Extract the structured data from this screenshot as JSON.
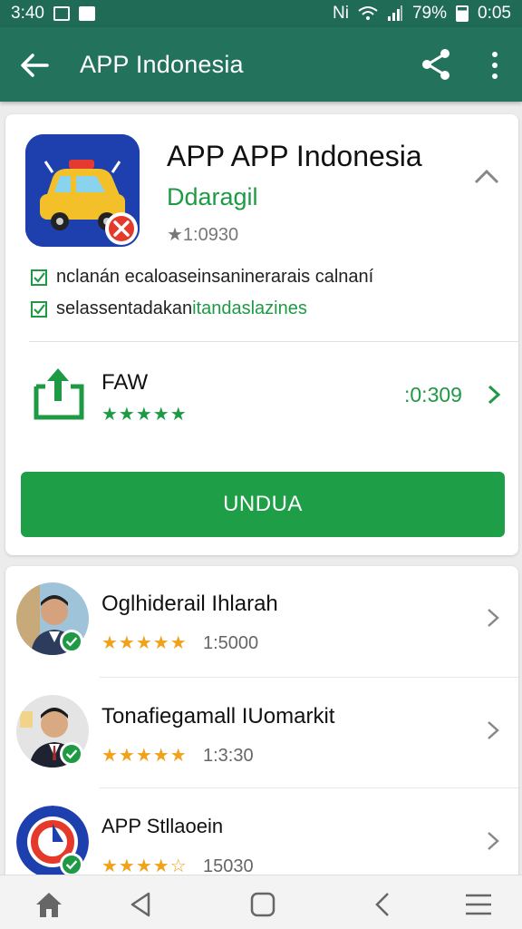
{
  "status_bar": {
    "time_left": "3:40",
    "signal_text": "Ni",
    "battery": "79%",
    "time_right": "0:05"
  },
  "app_bar": {
    "title": "APP Indonesia"
  },
  "app_card": {
    "name": "APP APP Indonesia",
    "developer": "Ddaragil",
    "rating": "★1:0930",
    "checks": [
      {
        "text": "nclanán ecaloaseinsaninerarais calnaní",
        "highlight": ""
      },
      {
        "text": "selassentadakan ",
        "highlight": "itandaslazines"
      }
    ],
    "feature": {
      "title": "FAW",
      "stars": "★★★★★",
      "value": ":0:309"
    },
    "download_label": "UNDUA"
  },
  "list": [
    {
      "title": "Oglhiderail Ihlarah",
      "stars": "★★★★★",
      "count": "1:5000"
    },
    {
      "title": "Tonafiegamall IUomarkit",
      "stars": "★★★★★",
      "count": "1:3:30"
    },
    {
      "title": "APP Stllaoein",
      "stars": "★★★★☆",
      "count": "15030"
    }
  ],
  "colors": {
    "primary": "#23735c",
    "accent_green": "#1f9e48",
    "star_gold": "#f0a21a",
    "icon_blue": "#1e3fae"
  },
  "icons": [
    "back-arrow-icon",
    "share-icon",
    "more-vert-icon",
    "chevron-up-icon",
    "chevron-right-icon",
    "checkbox-icon",
    "home-icon",
    "back-triangle-icon",
    "square-icon",
    "menu-icon"
  ]
}
